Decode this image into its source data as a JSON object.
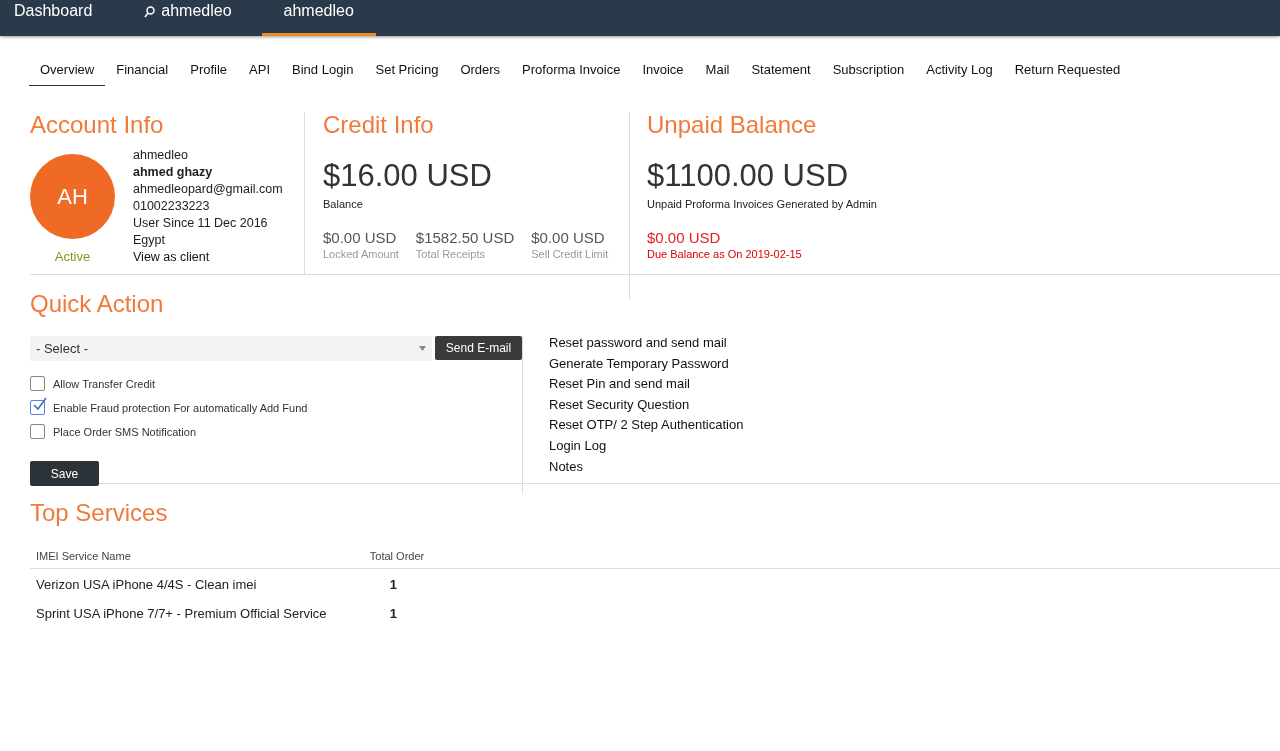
{
  "top_nav": [
    {
      "label": "Dashboard",
      "kind": "link",
      "selected": false
    },
    {
      "label": "ahmedleo",
      "kind": "search",
      "selected": false
    },
    {
      "label": "ahmedleo",
      "kind": "link",
      "selected": true
    }
  ],
  "tabs": [
    {
      "label": "Overview",
      "selected": true
    },
    {
      "label": "Financial",
      "selected": false
    },
    {
      "label": "Profile",
      "selected": false
    },
    {
      "label": "API",
      "selected": false
    },
    {
      "label": "Bind Login",
      "selected": false
    },
    {
      "label": "Set Pricing",
      "selected": false
    },
    {
      "label": "Orders",
      "selected": false
    },
    {
      "label": "Proforma Invoice",
      "selected": false
    },
    {
      "label": "Invoice",
      "selected": false
    },
    {
      "label": "Mail",
      "selected": false
    },
    {
      "label": "Statement",
      "selected": false
    },
    {
      "label": "Subscription",
      "selected": false
    },
    {
      "label": "Activity Log",
      "selected": false
    },
    {
      "label": "Return Requested",
      "selected": false
    }
  ],
  "account_info": {
    "title": "Account Info",
    "avatar_initials": "AH",
    "status": "Active",
    "username": "ahmedleo",
    "full_name": "ahmed ghazy",
    "email": "ahmedleopard@gmail.com",
    "phone": "01002233223",
    "since": "User Since 11 Dec 2016",
    "country": "Egypt",
    "link": "View as client"
  },
  "credit_info": {
    "title": "Credit Info",
    "amount": "$16.00 USD",
    "amount_label": "Balance",
    "stats": [
      {
        "value": "$0.00 USD",
        "label": "Locked Amount"
      },
      {
        "value": "$1582.50 USD",
        "label": "Total Receipts"
      },
      {
        "value": "$0.00 USD",
        "label": "Sell Credit Limit"
      }
    ]
  },
  "unpaid_balance": {
    "title": "Unpaid Balance",
    "amount": "$1100.00 USD",
    "amount_label": "Unpaid Proforma Invoices Generated by Admin",
    "due_value": "$0.00 USD",
    "due_label": "Due Balance as On 2019-02-15"
  },
  "quick_action": {
    "title": "Quick Action",
    "select": {
      "value": "- Select -"
    },
    "send_button": "Send E-mail",
    "options": [
      {
        "label": "Allow Transfer Credit",
        "checked": false
      },
      {
        "label": "Enable Fraud protection For automatically Add Fund",
        "checked": true
      },
      {
        "label": "Place Order SMS Notification",
        "checked": false
      }
    ],
    "save_button": "Save",
    "links": [
      "Reset password and send mail",
      "Generate Temporary Password",
      "Reset Pin and send mail",
      "Reset Security Question",
      "Reset OTP/ 2 Step Authentication",
      "Login Log",
      "Notes"
    ]
  },
  "top_services": {
    "title": "Top Services",
    "columns": [
      "IMEI Service Name",
      "Total Order"
    ],
    "rows": [
      {
        "name": "Verizon USA iPhone 4/4S - Clean imei",
        "total": "1"
      },
      {
        "name": "Sprint USA iPhone 7/7+ - Premium Official Service",
        "total": "1"
      }
    ]
  }
}
